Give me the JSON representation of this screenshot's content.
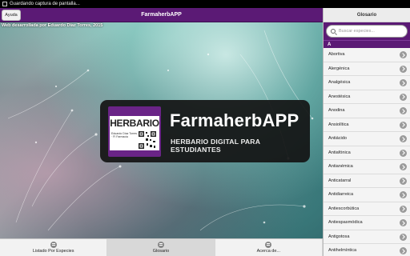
{
  "status_bar": {
    "notification": "Guardando captura de pantalla..."
  },
  "header": {
    "title": "FarmaherbAPP",
    "help_label": "Ayuda"
  },
  "hero": {
    "credit": "Web desarrollada por Eduardo Díaz Torres, 2015",
    "brand_title": "FarmaherbAPP",
    "brand_subtitle": "HERBARIO DIGITAL PARA ESTUDIANTES",
    "logo": {
      "word": "HERBARIO",
      "small_text": "Eduardo Díaz Torres · FI Farmacia"
    }
  },
  "bottom_nav": {
    "items": [
      {
        "label": "Listado Por Especies",
        "icon": "list-icon",
        "active": false
      },
      {
        "label": "Glosario",
        "icon": "list-icon",
        "active": true
      },
      {
        "label": "Acerca de...",
        "icon": "list-icon",
        "active": false
      }
    ]
  },
  "sidebar": {
    "title": "Glosario",
    "search": {
      "placeholder": "Buscar especies...",
      "value": ""
    },
    "section": "A",
    "items": [
      {
        "label": "Abortiva"
      },
      {
        "label": "Alergénica"
      },
      {
        "label": "Analgésica"
      },
      {
        "label": "Anestésica"
      },
      {
        "label": "Anodina"
      },
      {
        "label": "Ansiolítica"
      },
      {
        "label": "Antiácido"
      },
      {
        "label": "Antiafónica"
      },
      {
        "label": "Antianémica"
      },
      {
        "label": "Anticatarral"
      },
      {
        "label": "Antidiarreica"
      },
      {
        "label": "Antiescorbútica"
      },
      {
        "label": "Antiespasmódica"
      },
      {
        "label": "Antigotosa"
      },
      {
        "label": "Antihelmíntica"
      }
    ]
  },
  "colors": {
    "accent": "#5b1a75",
    "card": "#141414"
  }
}
